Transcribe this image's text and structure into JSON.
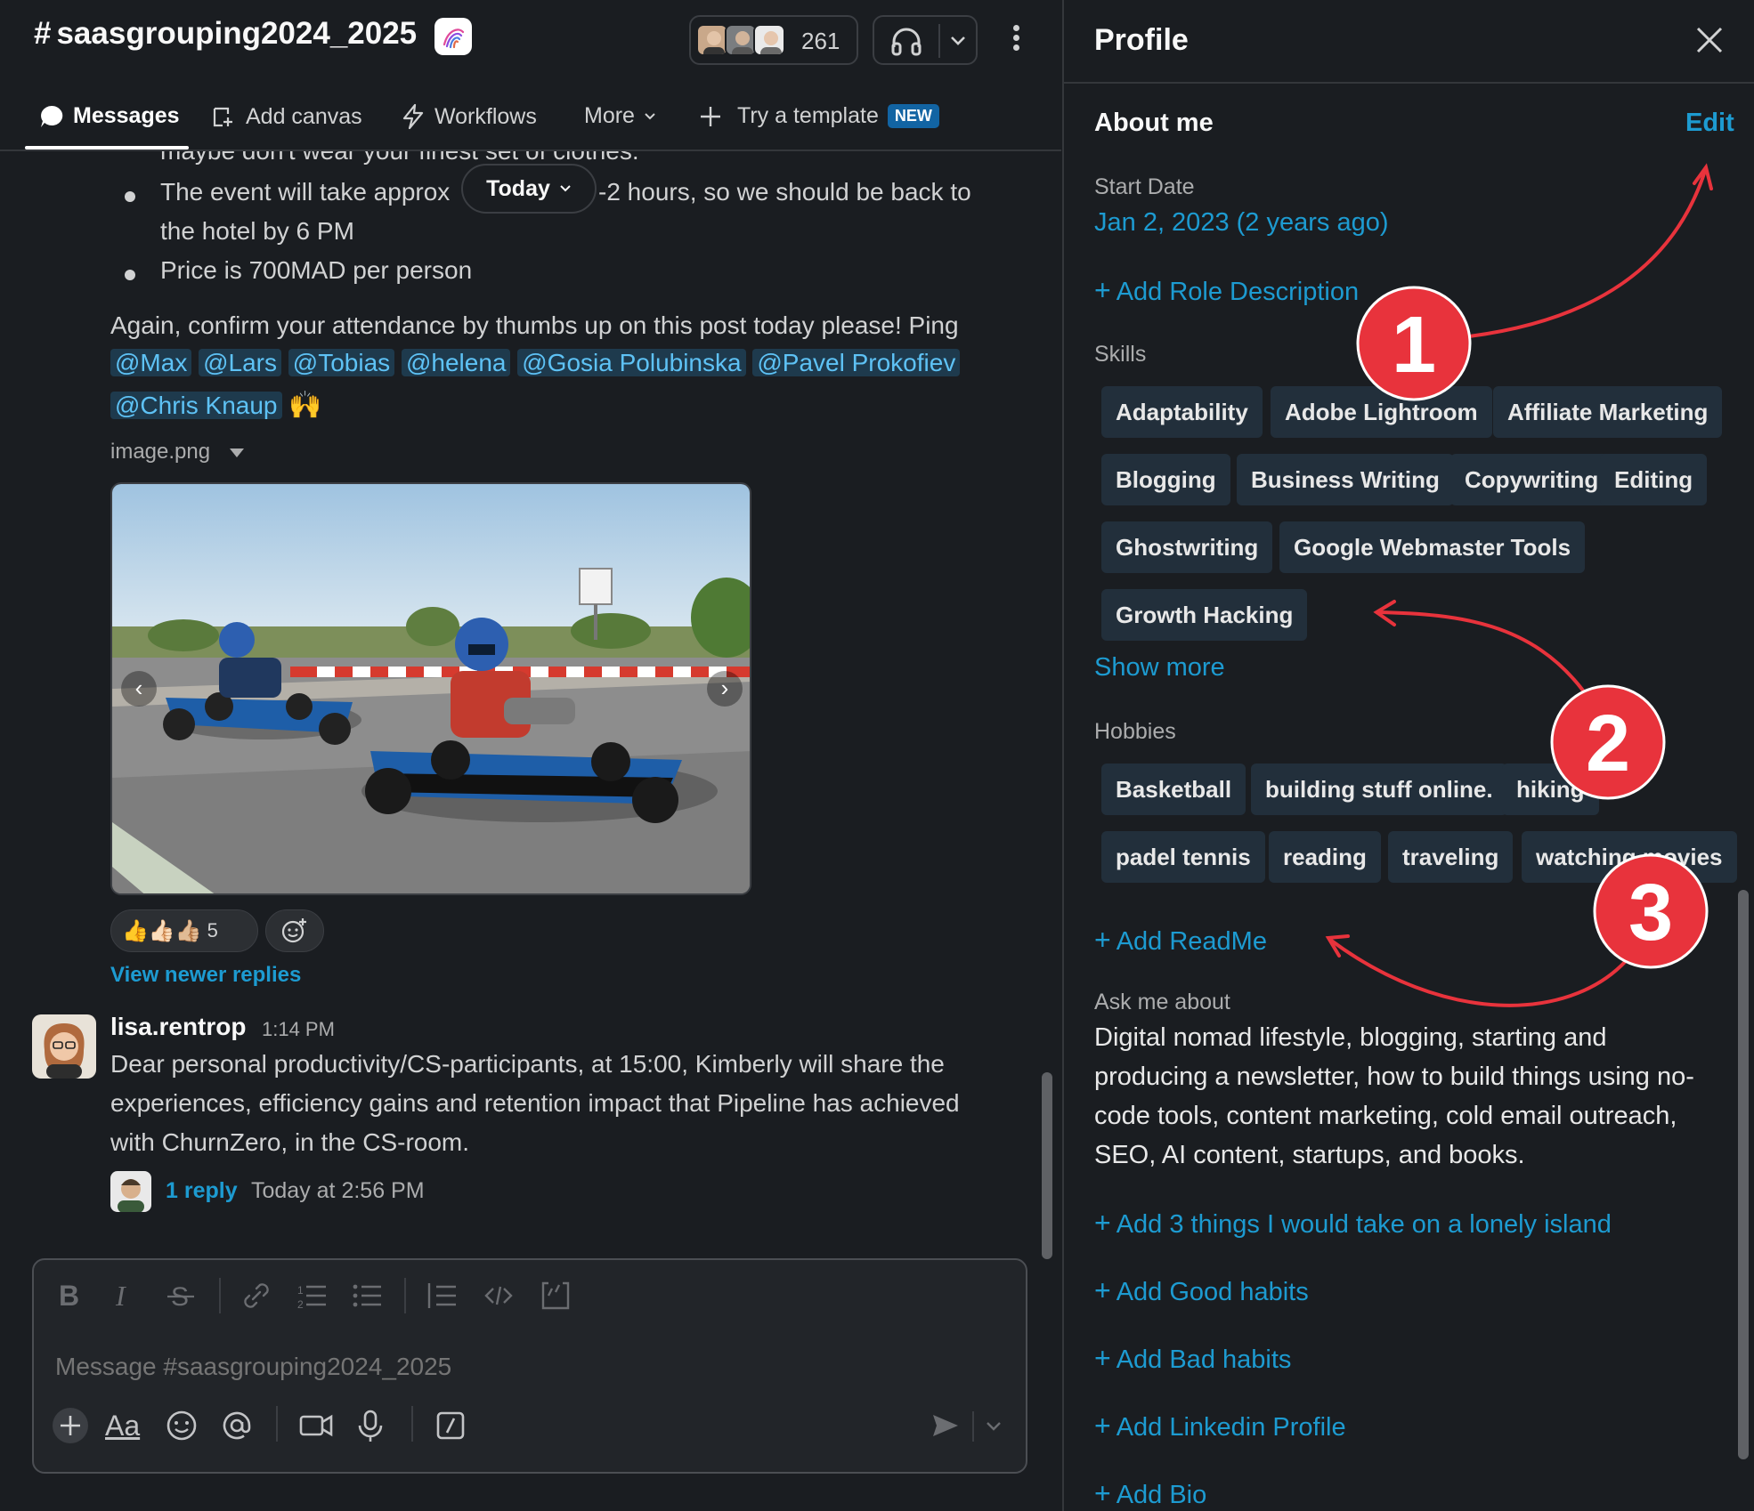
{
  "channel": {
    "hash": "#",
    "name": "saasgrouping2024_2025",
    "member_count": "261",
    "tabs": [
      {
        "label": "Messages"
      },
      {
        "label": "Add canvas"
      },
      {
        "label": "Workflows"
      },
      {
        "label": "More"
      },
      {
        "label": "Try a template"
      }
    ],
    "new_badge": "NEW",
    "date_pill": "Today"
  },
  "message1": {
    "line_partial": "maybe don't wear your finest set of clothes.",
    "bullet1_a": "The event will take approx",
    "bullet1_b": "-2 hours, so we should be back to",
    "bullet1_c": "the hotel by 6 PM",
    "bullet2": "Price is 700MAD per person",
    "para": "Again, confirm your attendance by thumbs up on this post today please! Ping",
    "mentions_row1": [
      "@Max",
      "@Lars",
      "@Tobias",
      "@helena",
      "@Gosia Polubinska",
      "@Pavel Prokofiev"
    ],
    "mentions_row2": [
      "@Chris Knaup"
    ],
    "raise_hands": "🙌",
    "file_name": "image.png",
    "reactions": {
      "emojis": "👍👍🏻👍🏼",
      "count": "5"
    },
    "newer_replies": "View newer replies"
  },
  "message2": {
    "author": "lisa.rentrop",
    "time": "1:14 PM",
    "lines": [
      "Dear personal productivity/CS-participants, at 15:00, Kimberly will share the",
      "experiences, efficiency gains and retention impact that Pipeline has achieved",
      "with ChurnZero, in the CS-room."
    ],
    "thread_replies": "1 reply",
    "thread_time": "Today at 2:56 PM"
  },
  "composer": {
    "placeholder": "Message #saasgrouping2024_2025",
    "format_label": "Aa"
  },
  "profile": {
    "title": "Profile",
    "about_heading": "About me",
    "edit_label": "Edit",
    "start_date_label": "Start Date",
    "start_date_value": "Jan 2, 2023 (2 years ago)",
    "add_role": "Add Role Description",
    "skills_label": "Skills",
    "skills": [
      "Adaptability",
      "Adobe Lightroom",
      "Affiliate Marketing",
      "Blogging",
      "Business Writing",
      "Copywriting",
      "Editing",
      "Ghostwriting",
      "Google Webmaster Tools",
      "Growth Hacking"
    ],
    "show_more": "Show more",
    "hobbies_label": "Hobbies",
    "hobbies": [
      "Basketball",
      "building stuff online.",
      "hiking",
      "padel tennis",
      "reading",
      "traveling",
      "watching movies"
    ],
    "add_readme": "Add ReadMe",
    "ask_label": "Ask me about",
    "ask_lines": [
      "Digital nomad lifestyle, blogging, starting and",
      "producing a newsletter, how to build things using no-",
      "code tools, content marketing, cold email outreach,",
      "SEO, AI content, startups, and books."
    ],
    "add_links": [
      "Add 3 things I would take on a lonely island",
      "Add Good habits",
      "Add Bad habits",
      "Add Linkedin Profile",
      "Add Bio"
    ]
  },
  "annotations": [
    "1",
    "2",
    "3"
  ],
  "colors": {
    "accent_link": "#1d9bd1",
    "annotation_red": "#e8333c",
    "chip_bg": "#222f3b"
  }
}
